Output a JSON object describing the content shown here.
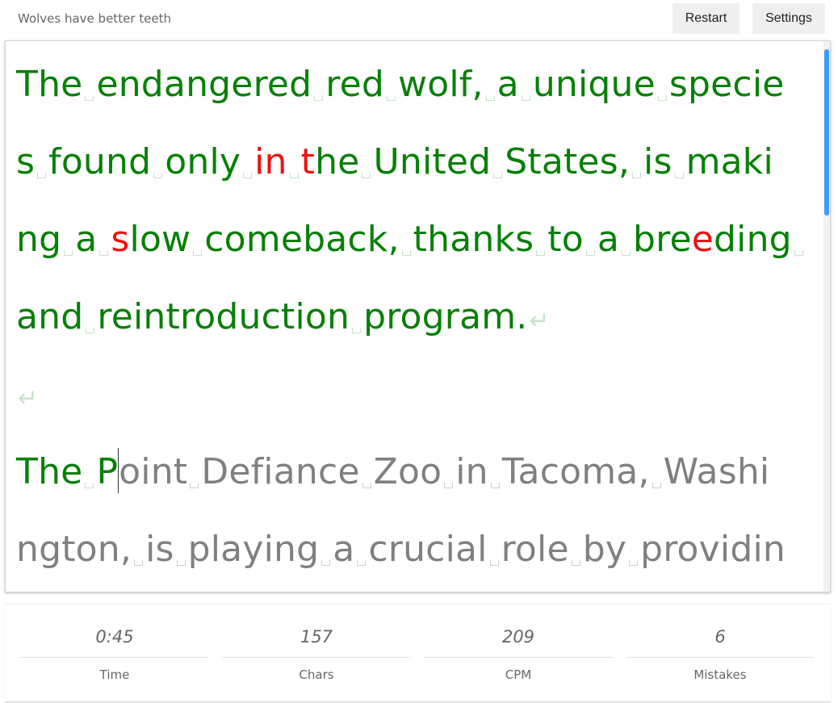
{
  "header": {
    "title": "Wolves have better teeth",
    "restart_label": "Restart",
    "settings_label": "Settings"
  },
  "text_lines": [
    [
      {
        "t": "The",
        "s": "ok"
      },
      {
        "sp": "ok"
      },
      {
        "t": "endangered",
        "s": "ok"
      },
      {
        "sp": "ok"
      },
      {
        "t": "red",
        "s": "ok"
      },
      {
        "sp": "ok"
      },
      {
        "t": "wolf,",
        "s": "ok"
      },
      {
        "sp": "ok"
      },
      {
        "t": "a",
        "s": "ok"
      },
      {
        "sp": "ok"
      },
      {
        "t": "unique",
        "s": "ok"
      },
      {
        "sp": "ok"
      },
      {
        "t": "specie",
        "s": "ok"
      }
    ],
    [
      {
        "t": "s",
        "s": "ok"
      },
      {
        "sp": "ok"
      },
      {
        "t": "found",
        "s": "ok"
      },
      {
        "sp": "ok"
      },
      {
        "t": "only",
        "s": "ok"
      },
      {
        "sp": "ok"
      },
      {
        "t": "in",
        "s": "bad"
      },
      {
        "sp": "ok"
      },
      {
        "t": "t",
        "s": "bad"
      },
      {
        "t": "he",
        "s": "ok"
      },
      {
        "sp": "ok"
      },
      {
        "t": "United",
        "s": "ok"
      },
      {
        "sp": "ok"
      },
      {
        "t": "States,",
        "s": "ok"
      },
      {
        "sp": "ok"
      },
      {
        "t": "is",
        "s": "ok"
      },
      {
        "sp": "ok"
      },
      {
        "t": "maki",
        "s": "ok"
      }
    ],
    [
      {
        "t": "ng",
        "s": "ok"
      },
      {
        "sp": "ok"
      },
      {
        "t": "a",
        "s": "ok"
      },
      {
        "sp": "ok"
      },
      {
        "t": "s",
        "s": "bad"
      },
      {
        "t": "low",
        "s": "ok"
      },
      {
        "sp": "ok"
      },
      {
        "t": "comeback,",
        "s": "ok"
      },
      {
        "sp": "ok"
      },
      {
        "t": "thanks",
        "s": "ok"
      },
      {
        "sp": "ok"
      },
      {
        "t": "to",
        "s": "ok"
      },
      {
        "sp": "ok"
      },
      {
        "t": "a",
        "s": "ok"
      },
      {
        "sp": "ok"
      },
      {
        "t": "bre",
        "s": "ok"
      },
      {
        "t": "e",
        "s": "bad"
      },
      {
        "t": "ding",
        "s": "ok"
      },
      {
        "sp": "ok"
      }
    ],
    [
      {
        "t": "and",
        "s": "ok"
      },
      {
        "sp": "ok"
      },
      {
        "t": "reintroduction",
        "s": "ok"
      },
      {
        "sp": "ok"
      },
      {
        "t": "program.",
        "s": "ok"
      },
      {
        "nl": true
      }
    ],
    [
      {
        "nl": true
      }
    ],
    [
      {
        "t": "The",
        "s": "ok"
      },
      {
        "sp": "ok"
      },
      {
        "t": "P",
        "s": "ok"
      },
      {
        "caret": true
      },
      {
        "t": "oint",
        "s": "pending"
      },
      {
        "sp": "pend"
      },
      {
        "t": "Defiance",
        "s": "pending"
      },
      {
        "sp": "pend"
      },
      {
        "t": "Zoo",
        "s": "pending"
      },
      {
        "sp": "pend"
      },
      {
        "t": "in",
        "s": "pending"
      },
      {
        "sp": "pend"
      },
      {
        "t": "Tacoma,",
        "s": "pending"
      },
      {
        "sp": "pend"
      },
      {
        "t": "Washi",
        "s": "pending"
      }
    ],
    [
      {
        "t": "ngton,",
        "s": "pending"
      },
      {
        "sp": "pend"
      },
      {
        "t": "is",
        "s": "pending"
      },
      {
        "sp": "pend"
      },
      {
        "t": "playing",
        "s": "pending"
      },
      {
        "sp": "pend"
      },
      {
        "t": "a",
        "s": "pending"
      },
      {
        "sp": "pend"
      },
      {
        "t": "crucial",
        "s": "pending"
      },
      {
        "sp": "pend"
      },
      {
        "t": "role",
        "s": "pending"
      },
      {
        "sp": "pend"
      },
      {
        "t": "by",
        "s": "pending"
      },
      {
        "sp": "pend"
      },
      {
        "t": "providin",
        "s": "pending"
      }
    ]
  ],
  "stats": [
    {
      "value": "0:45",
      "label": "Time"
    },
    {
      "value": "157",
      "label": "Chars"
    },
    {
      "value": "209",
      "label": "CPM"
    },
    {
      "value": "6",
      "label": "Mistakes"
    }
  ],
  "colors": {
    "correct": "#078007",
    "mistake": "#ee1111",
    "pending": "#808080",
    "scrollbar": "#3b9cff"
  },
  "icons": {
    "space_marker": "space-marker-icon",
    "newline_marker": "return-arrow-icon"
  }
}
